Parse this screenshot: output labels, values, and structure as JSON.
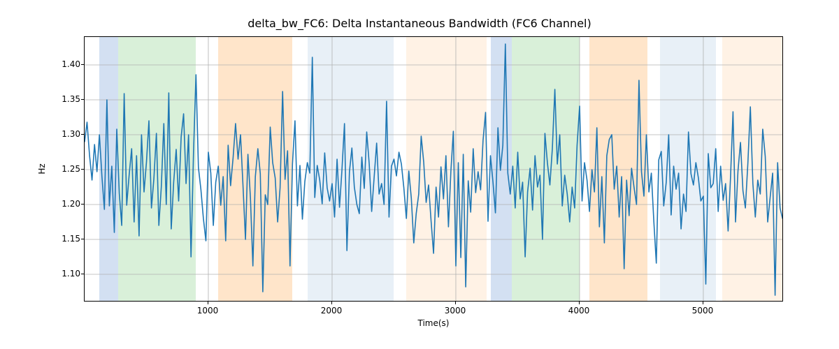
{
  "chart_data": {
    "type": "line",
    "title": "delta_bw_FC6: Delta Instantaneous Bandwidth (FC6 Channel)",
    "xlabel": "Time(s)",
    "ylabel": "Hz",
    "xlim": [
      0,
      5650
    ],
    "ylim": [
      1.06,
      1.44
    ],
    "xticks": [
      1000,
      2000,
      3000,
      4000,
      5000
    ],
    "yticks": [
      1.1,
      1.15,
      1.2,
      1.25,
      1.3,
      1.35,
      1.4
    ],
    "bands": [
      {
        "x0": 120,
        "x1": 270,
        "color": "#aec7e8",
        "alpha": 0.55
      },
      {
        "x0": 270,
        "x1": 900,
        "color": "#b9e3b9",
        "alpha": 0.55
      },
      {
        "x0": 1080,
        "x1": 1680,
        "color": "#ffcf9e",
        "alpha": 0.55
      },
      {
        "x0": 1800,
        "x1": 2500,
        "color": "#d6e4f0",
        "alpha": 0.55
      },
      {
        "x0": 2600,
        "x1": 3250,
        "color": "#ffe7cf",
        "alpha": 0.55
      },
      {
        "x0": 3280,
        "x1": 3450,
        "color": "#aec7e8",
        "alpha": 0.55
      },
      {
        "x0": 3450,
        "x1": 4000,
        "color": "#b9e3b9",
        "alpha": 0.55
      },
      {
        "x0": 4080,
        "x1": 4550,
        "color": "#ffcf9e",
        "alpha": 0.55
      },
      {
        "x0": 4650,
        "x1": 5100,
        "color": "#d6e4f0",
        "alpha": 0.55
      },
      {
        "x0": 5150,
        "x1": 5650,
        "color": "#ffe7cf",
        "alpha": 0.55
      }
    ],
    "series": [
      {
        "name": "delta_bw_FC6",
        "color": "#1f77b4",
        "x_step": 20,
        "x_start": 0,
        "values": [
          1.29,
          1.318,
          1.27,
          1.235,
          1.286,
          1.247,
          1.3,
          1.24,
          1.193,
          1.35,
          1.198,
          1.255,
          1.16,
          1.308,
          1.216,
          1.17,
          1.359,
          1.199,
          1.242,
          1.28,
          1.175,
          1.27,
          1.155,
          1.3,
          1.218,
          1.261,
          1.32,
          1.195,
          1.237,
          1.302,
          1.17,
          1.225,
          1.316,
          1.2,
          1.36,
          1.165,
          1.232,
          1.279,
          1.205,
          1.297,
          1.33,
          1.23,
          1.3,
          1.125,
          1.275,
          1.386,
          1.253,
          1.221,
          1.18,
          1.148,
          1.275,
          1.245,
          1.17,
          1.232,
          1.255,
          1.199,
          1.24,
          1.148,
          1.285,
          1.227,
          1.267,
          1.316,
          1.265,
          1.3,
          1.228,
          1.15,
          1.272,
          1.209,
          1.112,
          1.24,
          1.28,
          1.244,
          1.075,
          1.214,
          1.2,
          1.311,
          1.26,
          1.238,
          1.175,
          1.224,
          1.362,
          1.236,
          1.277,
          1.112,
          1.258,
          1.32,
          1.198,
          1.256,
          1.179,
          1.233,
          1.26,
          1.245,
          1.411,
          1.21,
          1.256,
          1.235,
          1.201,
          1.274,
          1.224,
          1.205,
          1.23,
          1.182,
          1.265,
          1.196,
          1.25,
          1.316,
          1.134,
          1.247,
          1.281,
          1.225,
          1.2,
          1.187,
          1.268,
          1.223,
          1.304,
          1.258,
          1.19,
          1.24,
          1.288,
          1.215,
          1.23,
          1.2,
          1.348,
          1.182,
          1.255,
          1.265,
          1.241,
          1.275,
          1.258,
          1.224,
          1.18,
          1.248,
          1.209,
          1.145,
          1.187,
          1.215,
          1.298,
          1.261,
          1.203,
          1.228,
          1.176,
          1.13,
          1.225,
          1.182,
          1.254,
          1.208,
          1.27,
          1.168,
          1.248,
          1.305,
          1.112,
          1.26,
          1.124,
          1.272,
          1.082,
          1.234,
          1.189,
          1.28,
          1.217,
          1.247,
          1.221,
          1.292,
          1.332,
          1.176,
          1.27,
          1.232,
          1.188,
          1.31,
          1.249,
          1.285,
          1.43,
          1.245,
          1.215,
          1.255,
          1.195,
          1.275,
          1.208,
          1.232,
          1.125,
          1.218,
          1.252,
          1.192,
          1.27,
          1.225,
          1.242,
          1.15,
          1.302,
          1.26,
          1.228,
          1.28,
          1.365,
          1.258,
          1.3,
          1.198,
          1.242,
          1.215,
          1.175,
          1.225,
          1.195,
          1.285,
          1.341,
          1.205,
          1.26,
          1.235,
          1.19,
          1.25,
          1.218,
          1.31,
          1.168,
          1.24,
          1.145,
          1.27,
          1.293,
          1.3,
          1.222,
          1.255,
          1.182,
          1.24,
          1.108,
          1.235,
          1.184,
          1.252,
          1.225,
          1.2,
          1.378,
          1.247,
          1.212,
          1.3,
          1.218,
          1.245,
          1.175,
          1.116,
          1.264,
          1.276,
          1.198,
          1.232,
          1.3,
          1.185,
          1.255,
          1.222,
          1.245,
          1.165,
          1.215,
          1.19,
          1.304,
          1.244,
          1.228,
          1.26,
          1.238,
          1.205,
          1.212,
          1.086,
          1.273,
          1.224,
          1.23,
          1.28,
          1.19,
          1.255,
          1.206,
          1.23,
          1.162,
          1.24,
          1.333,
          1.175,
          1.248,
          1.289,
          1.22,
          1.195,
          1.26,
          1.34,
          1.23,
          1.182,
          1.235,
          1.215,
          1.308,
          1.269,
          1.175,
          1.21,
          1.245,
          1.07,
          1.26,
          1.195,
          1.18
        ]
      }
    ]
  }
}
